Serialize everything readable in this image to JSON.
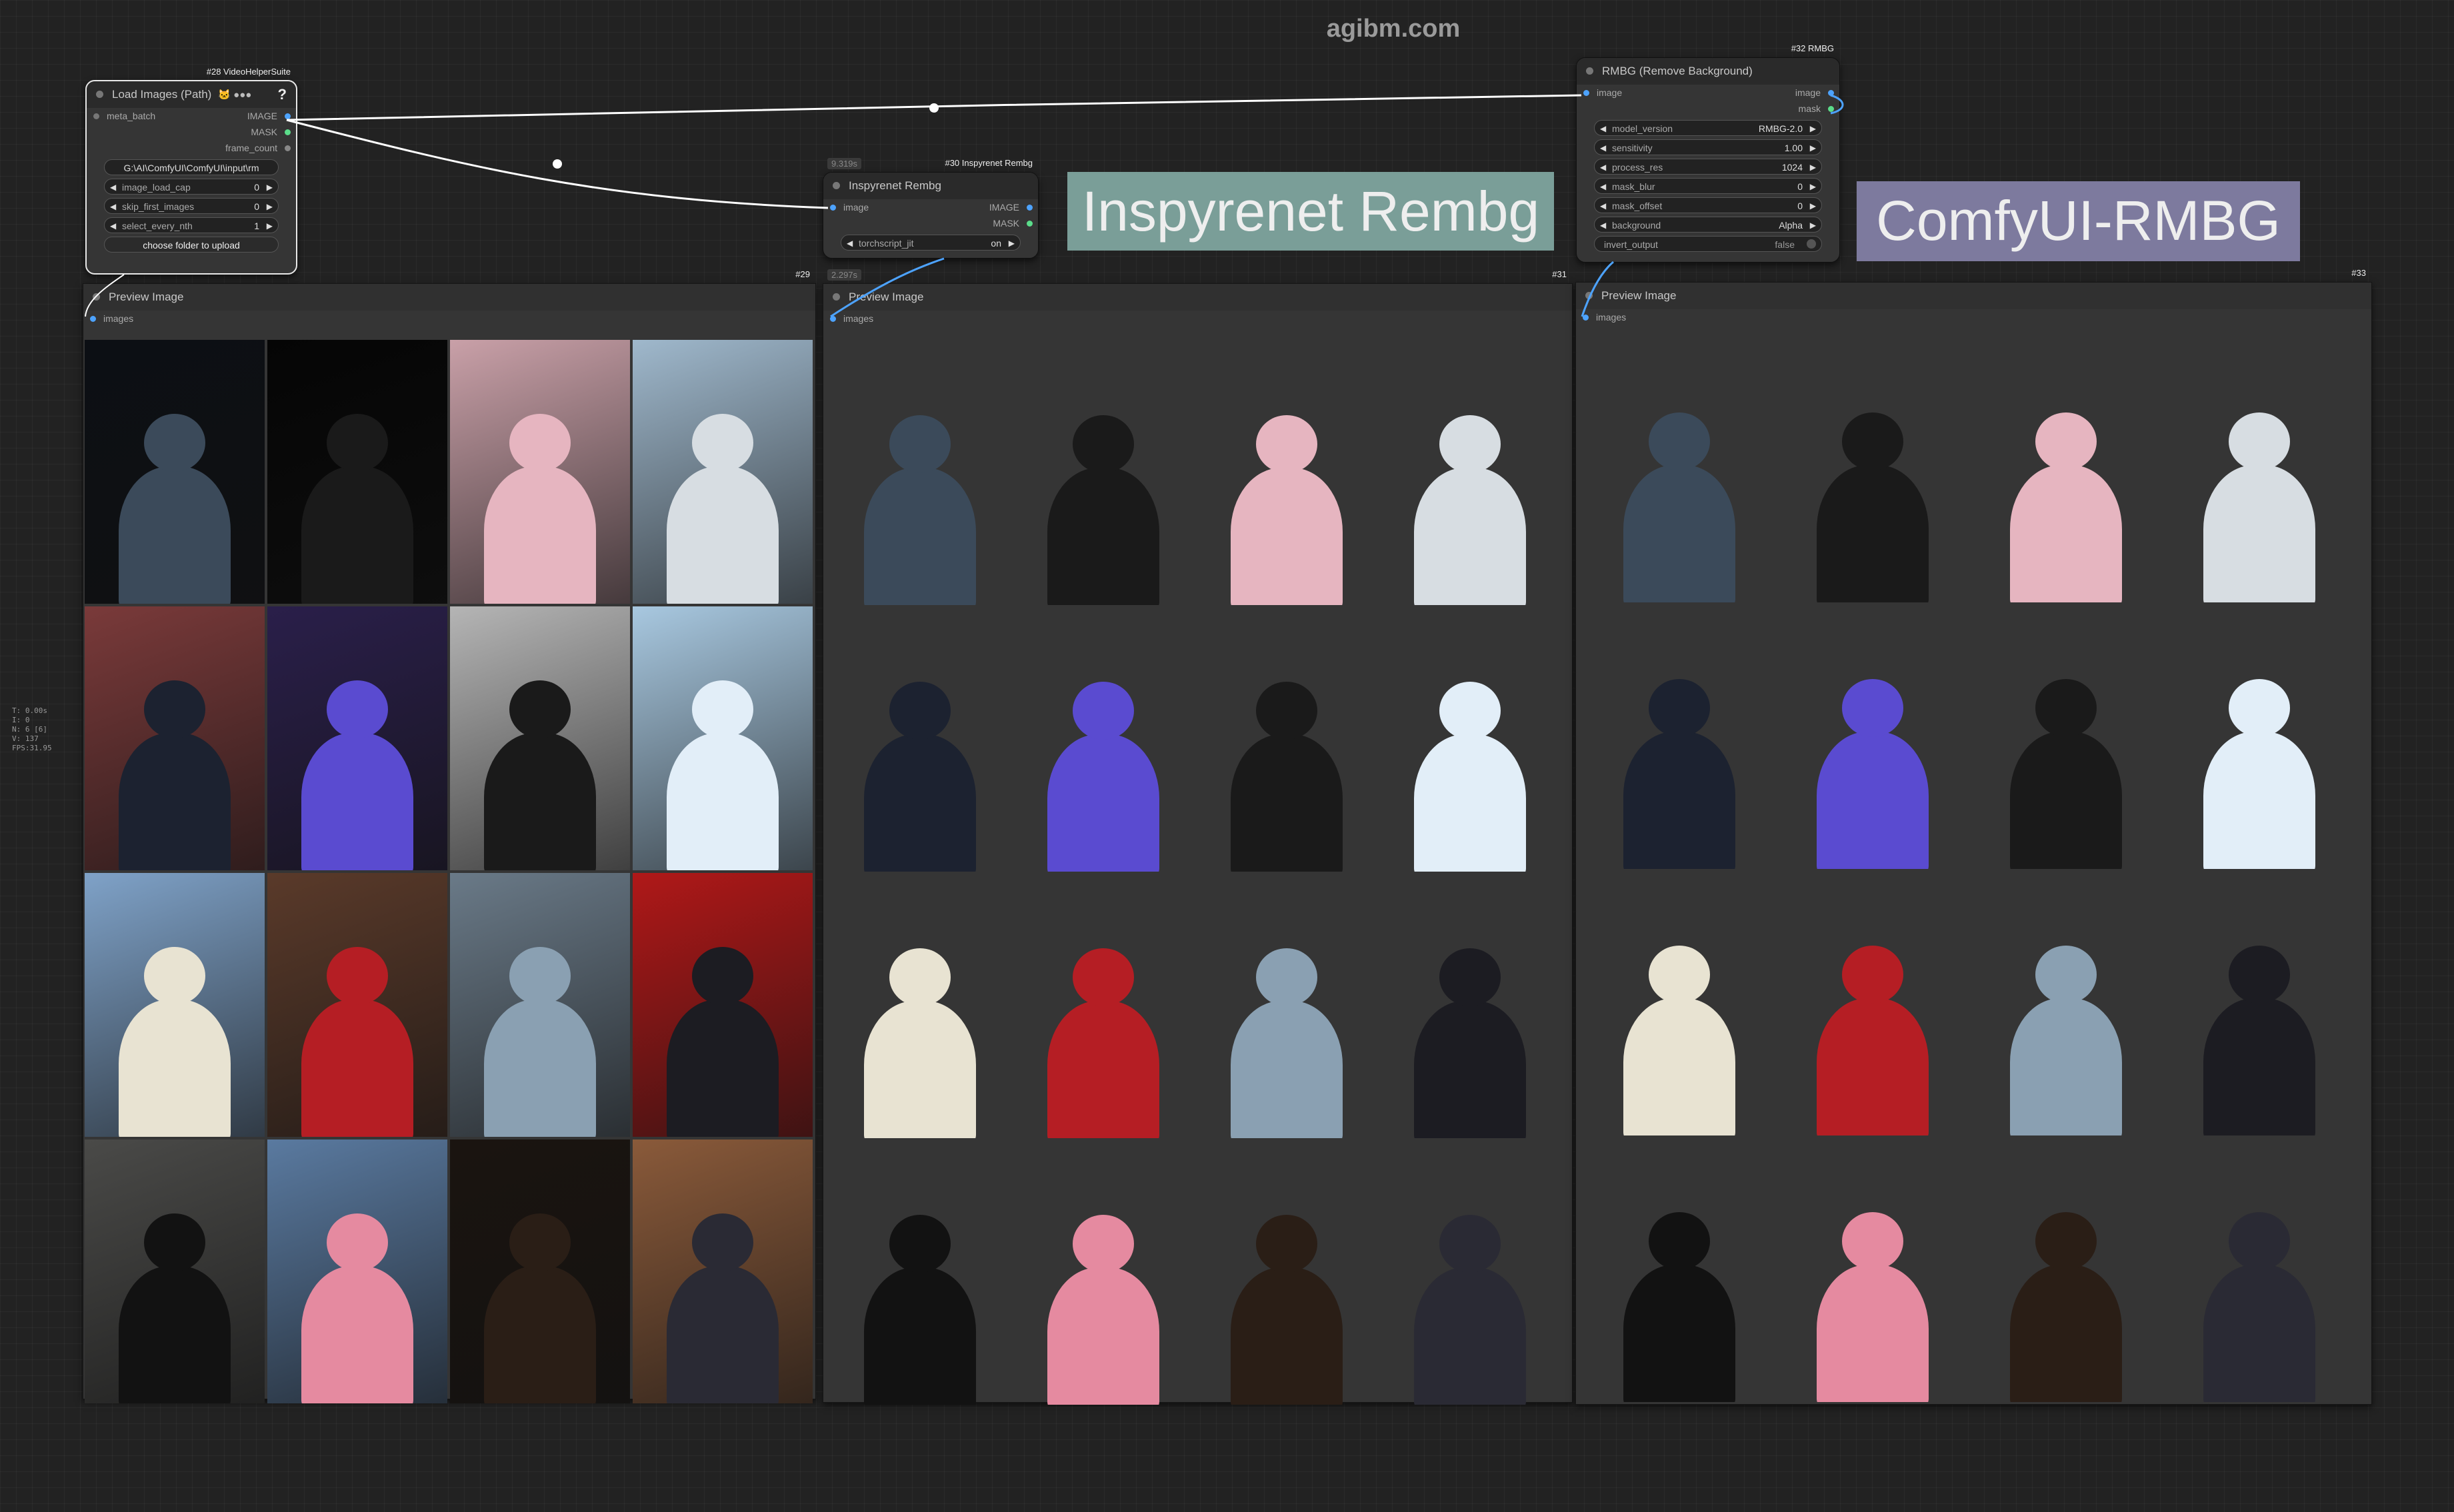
{
  "watermark": "agibm.com",
  "stats": [
    "T: 0.00s",
    "I: 0",
    "N: 6 [6]",
    "V: 137",
    "FPS:31.95"
  ],
  "colors": {
    "canvas": "#222222",
    "node": "#353535",
    "link_image": "#ffffff",
    "link_mask": "#5bdc8a",
    "slot_image": "#4da3ff"
  },
  "nodes": {
    "load_images": {
      "id": "#28 VideoHelperSuite",
      "title": "Load Images (Path)",
      "title_extra": "🐱 ●●●",
      "help": "?",
      "input": "meta_batch",
      "outputs": [
        "IMAGE",
        "MASK",
        "frame_count"
      ],
      "directory": "G:\\AI\\ComfyUI\\ComfyUI\\input\\rm",
      "widgets": [
        {
          "name": "image_load_cap",
          "value": "0"
        },
        {
          "name": "skip_first_images",
          "value": "0"
        },
        {
          "name": "select_every_nth",
          "value": "1"
        }
      ],
      "button": "choose folder to upload"
    },
    "inspyrenet": {
      "id": "#30 Inspyrenet Rembg",
      "time": "9.319s",
      "title": "Inspyrenet Rembg",
      "input": "image",
      "outputs": [
        "IMAGE",
        "MASK"
      ],
      "widgets": [
        {
          "name": "torchscript_jit",
          "value": "on"
        }
      ]
    },
    "rmbg": {
      "id": "#32 RMBG",
      "title": "RMBG (Remove Background)",
      "input": "image",
      "outputs": [
        "image",
        "mask"
      ],
      "widgets": [
        {
          "name": "model_version",
          "value": "RMBG-2.0"
        },
        {
          "name": "sensitivity",
          "value": "1.00"
        },
        {
          "name": "process_res",
          "value": "1024"
        },
        {
          "name": "mask_blur",
          "value": "0"
        },
        {
          "name": "mask_offset",
          "value": "0"
        },
        {
          "name": "background",
          "value": "Alpha"
        }
      ],
      "toggle": {
        "name": "invert_output",
        "value": "false"
      }
    }
  },
  "previews": [
    {
      "id": "#29",
      "time": "",
      "title": "Preview Image",
      "input": "images"
    },
    {
      "id": "#31",
      "time": "2.297s",
      "title": "Preview Image",
      "input": "images"
    },
    {
      "id": "#33",
      "time": "",
      "title": "Preview Image",
      "input": "images"
    }
  ],
  "groups": [
    {
      "label": "Inspyrenet Rembg",
      "color": "#7a9e98"
    },
    {
      "label": "ComfyUI-RMBG",
      "color": "#7d7a9e"
    }
  ],
  "image_palette": [
    {
      "bg": "#0c0f14",
      "fig": "#3b4a5a"
    },
    {
      "bg": "#050505",
      "fig": "#1a1a1a"
    },
    {
      "bg": "#c9a0a8",
      "fig": "#e6b5c0"
    },
    {
      "bg": "#9fb8cc",
      "fig": "#d7dde2"
    },
    {
      "bg": "#7a3a3a",
      "fig": "#1c2230"
    },
    {
      "bg": "#2a1f4a",
      "fig": "#5a4bd0"
    },
    {
      "bg": "#b5b5b5",
      "fig": "#1a1a1a"
    },
    {
      "bg": "#a8c8e0",
      "fig": "#e2eef8"
    },
    {
      "bg": "#7fa2c8",
      "fig": "#e8e3d2"
    },
    {
      "bg": "#5a3a2a",
      "fig": "#b51e24"
    },
    {
      "bg": "#6a7a88",
      "fig": "#8aa0b2"
    },
    {
      "bg": "#b01818",
      "fig": "#1c1c22"
    },
    {
      "bg": "#4a4a48",
      "fig": "#121212"
    },
    {
      "bg": "#5a7aa0",
      "fig": "#e58aa0"
    },
    {
      "bg": "#1a1410",
      "fig": "#2a1e16"
    },
    {
      "bg": "#8a5a3a",
      "fig": "#2a2a34"
    }
  ]
}
